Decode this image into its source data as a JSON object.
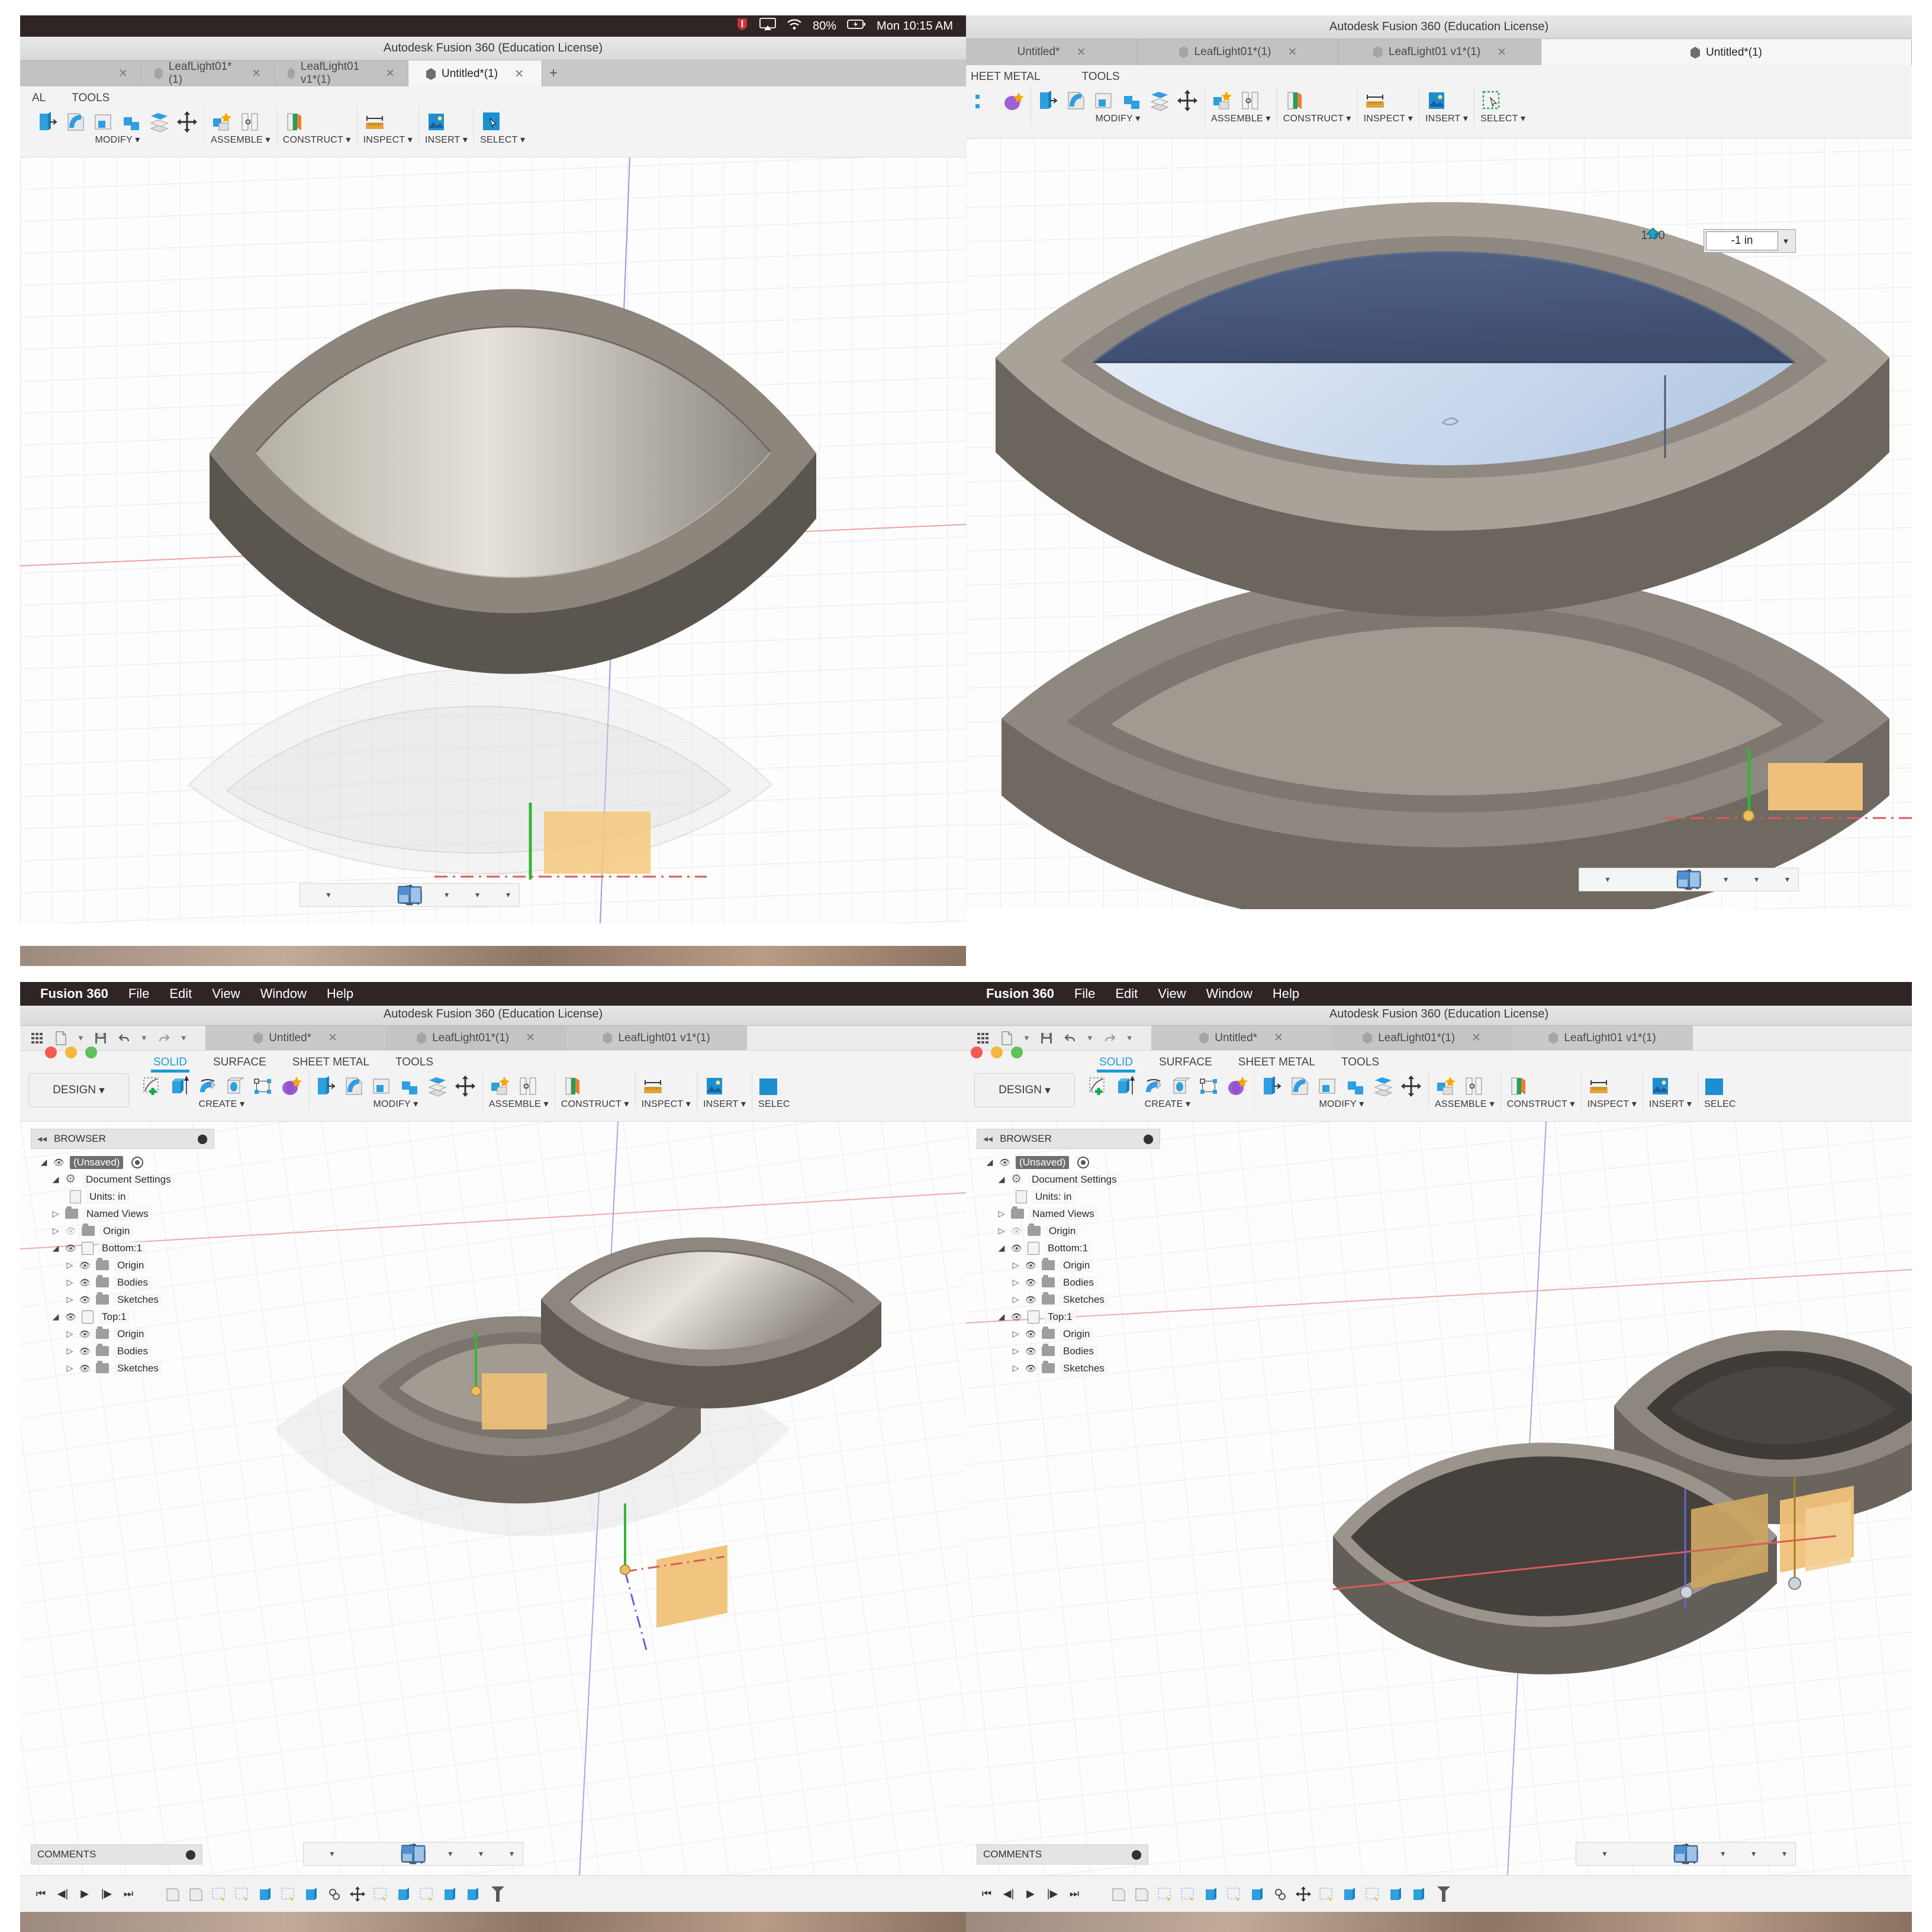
{
  "app": {
    "title": "Autodesk Fusion 360 (Education License)",
    "brand": "Fusion 360"
  },
  "macbar": {
    "menus": [
      "Fusion 360",
      "File",
      "Edit",
      "View",
      "Window",
      "Help"
    ],
    "status": {
      "battery": "80%",
      "clock": "Mon 10:15 AM",
      "wifi_icon": "wifi-icon",
      "airplay_icon": "airplay-icon",
      "app_icon": "app-status-icon"
    }
  },
  "tabs": [
    {
      "label": "Untitled*",
      "active": false,
      "closeable": true
    },
    {
      "label": "LeafLight01*(1)",
      "active": false,
      "closeable": true
    },
    {
      "label": "LeafLight01 v1*(1)",
      "active": false,
      "closeable": true
    },
    {
      "label": "Untitled*(1)",
      "active": true,
      "closeable": true
    }
  ],
  "quickaccess": {
    "items": [
      "grid-icon",
      "new-document-icon",
      "save-icon",
      "undo-icon",
      "redo-icon"
    ]
  },
  "ribbon": {
    "workspace": "DESIGN",
    "tabs": [
      {
        "label": "SOLID",
        "selected": true
      },
      {
        "label": "SURFACE",
        "selected": false
      },
      {
        "label": "SHEET METAL",
        "selected": false
      },
      {
        "label": "TOOLS",
        "selected": false
      }
    ],
    "groups": [
      {
        "label": "CREATE",
        "icons": [
          "create-sketch-icon",
          "extrude-icon",
          "revolve-icon",
          "hole-icon",
          "pattern-icon",
          "form-icon"
        ]
      },
      {
        "label": "MODIFY",
        "icons": [
          "press-pull-icon",
          "fillet-icon",
          "shell-icon",
          "combine-icon",
          "offset-face-icon",
          "move-copy-icon"
        ]
      },
      {
        "label": "ASSEMBLE",
        "icons": [
          "new-component-icon",
          "joint-icon"
        ]
      },
      {
        "label": "CONSTRUCT",
        "icons": [
          "offset-plane-icon"
        ]
      },
      {
        "label": "INSPECT",
        "icons": [
          "measure-icon"
        ]
      },
      {
        "label": "INSERT",
        "icons": [
          "insert-image-icon"
        ]
      },
      {
        "label": "SELECT",
        "icons": [
          "select-window-icon"
        ]
      }
    ]
  },
  "browser": {
    "title": "BROWSER",
    "collapse_icon": "collapse-left-icon",
    "pin_icon": "panel-menu-icon",
    "nodes": [
      {
        "label": "(Unsaved)",
        "indent": 0,
        "twist": "down",
        "eye": "on",
        "icon": "document-icon",
        "selected": true,
        "radio": true
      },
      {
        "label": "Document Settings",
        "indent": 1,
        "twist": "down",
        "eye": "none",
        "icon": "gear-icon",
        "selected": false,
        "radio": false
      },
      {
        "label": "Units: in",
        "indent": 2,
        "twist": "none",
        "eye": "none",
        "icon": "units-icon",
        "selected": false,
        "radio": false
      },
      {
        "label": "Named Views",
        "indent": 1,
        "twist": "right",
        "eye": "none",
        "icon": "folder-icon",
        "selected": false,
        "radio": false
      },
      {
        "label": "Origin",
        "indent": 1,
        "twist": "right",
        "eye": "off",
        "icon": "folder-icon",
        "selected": false,
        "radio": false
      },
      {
        "label": "Bottom:1",
        "indent": 1,
        "twist": "down",
        "eye": "on",
        "icon": "component-icon",
        "selected": false,
        "radio": false
      },
      {
        "label": "Origin",
        "indent": 2,
        "twist": "right",
        "eye": "on",
        "icon": "folder-icon",
        "selected": false,
        "radio": false
      },
      {
        "label": "Bodies",
        "indent": 2,
        "twist": "right",
        "eye": "on",
        "icon": "folder-icon",
        "selected": false,
        "radio": false
      },
      {
        "label": "Sketches",
        "indent": 2,
        "twist": "right",
        "eye": "on",
        "icon": "folder-icon",
        "selected": false,
        "radio": false
      },
      {
        "label": "Top:1",
        "indent": 1,
        "twist": "down",
        "eye": "on",
        "icon": "component-icon",
        "selected": false,
        "radio": false
      },
      {
        "label": "Origin",
        "indent": 2,
        "twist": "right",
        "eye": "on",
        "icon": "folder-icon",
        "selected": false,
        "radio": false
      },
      {
        "label": "Bodies",
        "indent": 2,
        "twist": "right",
        "eye": "on",
        "icon": "folder-icon",
        "selected": false,
        "radio": false
      },
      {
        "label": "Sketches",
        "indent": 2,
        "twist": "right",
        "eye": "on",
        "icon": "folder-icon",
        "selected": false,
        "radio": false
      }
    ]
  },
  "comments": {
    "title": "COMMENTS",
    "pin_icon": "panel-menu-icon"
  },
  "navbar": {
    "items": [
      "orbit-icon",
      "orbit-dropdown",
      "pan-icon",
      "zoom-icon",
      "zoom-fit-icon",
      "fit-dropdown",
      "display-settings-icon",
      "display-dropdown",
      "grid-snaps-icon",
      "grid-dropdown",
      "viewports-icon",
      "viewports-dropdown"
    ]
  },
  "timeline": {
    "controls": [
      "go-to-beginning-icon",
      "step-back-icon",
      "play-icon",
      "step-forward-icon",
      "go-to-end-icon"
    ],
    "features": [
      "body-icon",
      "body-icon",
      "sketch-icon",
      "sketch-icon",
      "extrude-icon",
      "sketch-icon",
      "extrude-icon",
      "joint-icon",
      "move-icon",
      "sketch-icon",
      "extrude-icon",
      "sketch-icon",
      "extrude-icon",
      "extrude-icon"
    ],
    "marker": "timeline-marker"
  },
  "viewport": {
    "dimension_input": {
      "value": "-1 in",
      "dropdown_icon": "chevron-down-icon"
    },
    "manipulator": {
      "value": "1.00",
      "arrow_icon": "extrude-arrow-icon"
    }
  },
  "colors": {
    "accent": "#1c9bd6",
    "selected_face": "#4d5f7d",
    "body_grey": "#8e8880",
    "body_dark": "#5c564f",
    "sketch_orange": "#f0b959",
    "axis_red": "#e06666",
    "axis_green": "#35b535",
    "axis_blue": "#6464d8"
  },
  "panels": [
    {
      "id": "top-left",
      "kind": "viewport-only",
      "has_macbar": true,
      "has_browser": false
    },
    {
      "id": "top-right",
      "kind": "viewport-only",
      "has_macbar": false,
      "has_browser": false
    },
    {
      "id": "bottom-left",
      "kind": "full-window",
      "has_macbar": true,
      "has_browser": true
    },
    {
      "id": "bottom-right",
      "kind": "full-window",
      "has_macbar": true,
      "has_browser": true
    }
  ]
}
